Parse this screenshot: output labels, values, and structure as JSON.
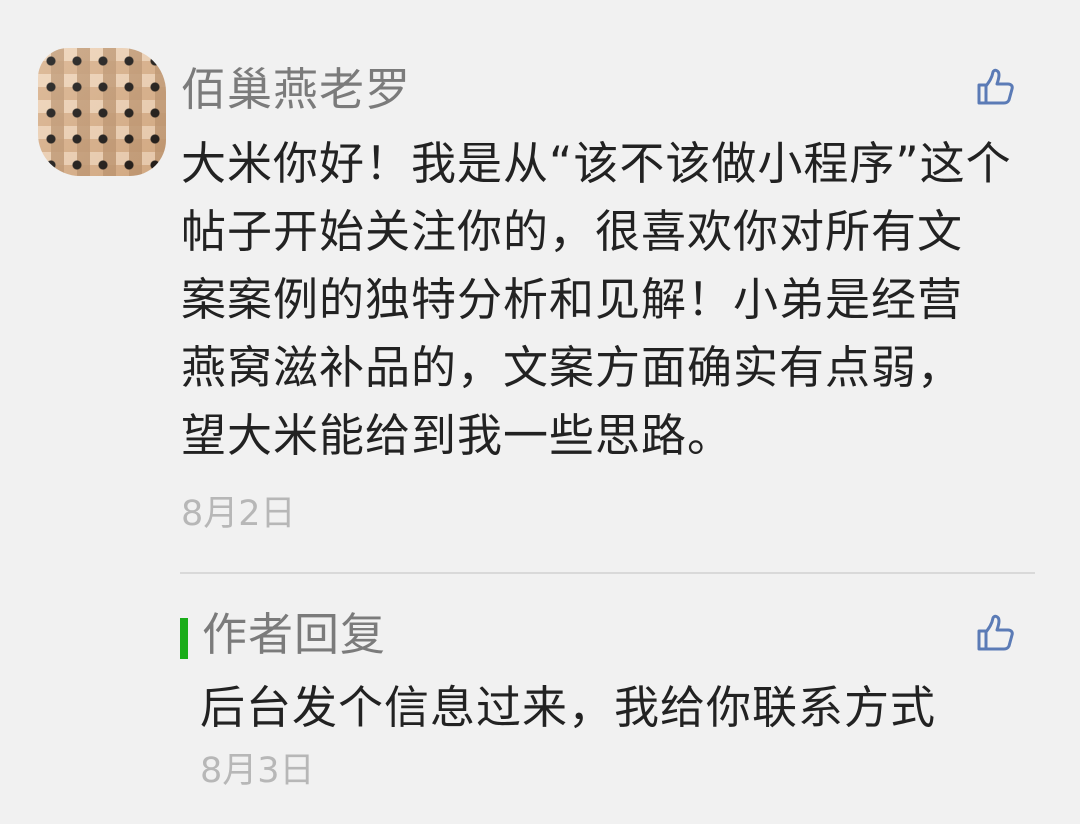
{
  "comment": {
    "author": "佰巢燕老罗",
    "text": "大米你好！我是从“该不该做小程序”这个\n帖子开始关注你的，很喜欢你对所有文\n案案例的独特分析和见解！小弟是经营\n燕窝滋补品的，文案方面确实有点弱，\n望大米能给到我一些思路。",
    "date": "8月2日",
    "like_icon": "thumbs-up-icon"
  },
  "reply": {
    "title": "作者回复",
    "text": "后台发个信息过来，我给你联系方式",
    "date": "8月3日",
    "like_icon": "thumbs-up-icon"
  },
  "colors": {
    "background": "#f1f1f1",
    "text": "#222222",
    "muted": "#7b7b7b",
    "date": "#b7b7b7",
    "accent": "#1aad19",
    "like": "#5b7bb6",
    "divider": "#d9d9d9"
  }
}
